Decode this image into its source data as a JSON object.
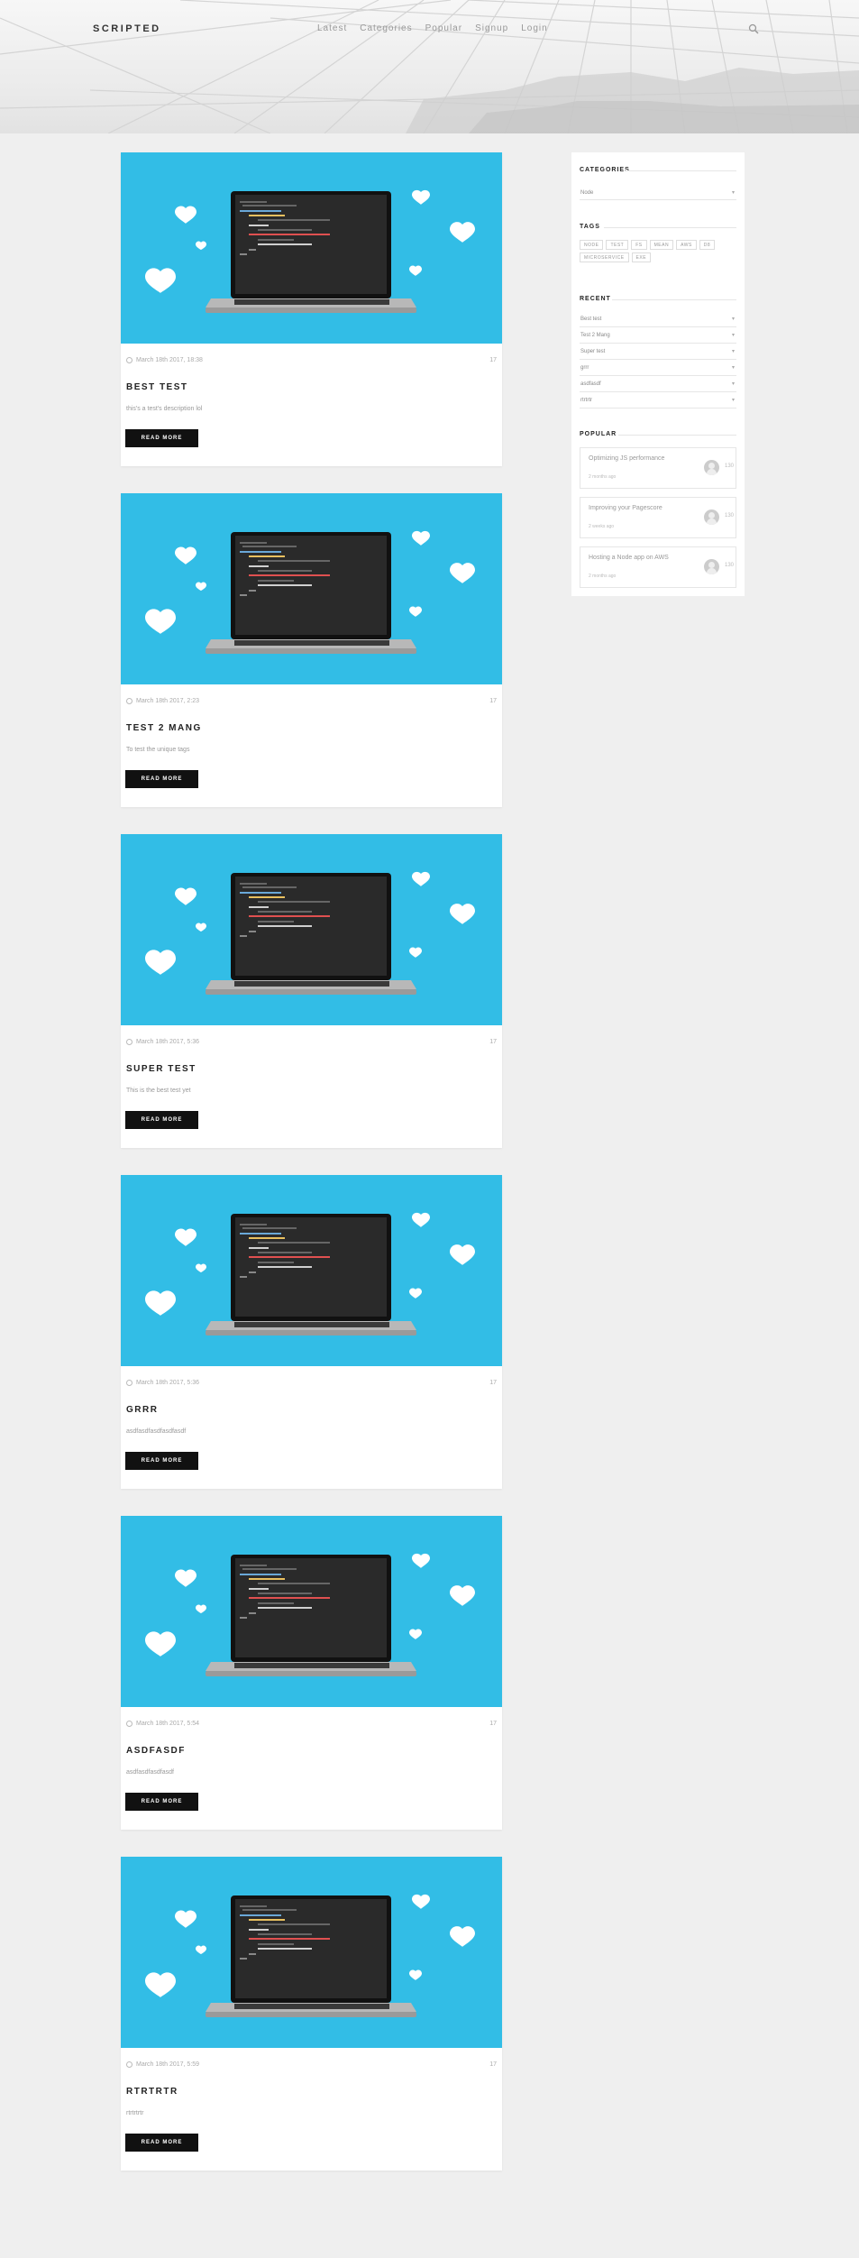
{
  "header": {
    "logo": "SCRIPTED",
    "nav": [
      "Latest",
      "Categories",
      "Popular",
      "Signup",
      "Login"
    ]
  },
  "posts": [
    {
      "date": "March 18th 2017, 18:38",
      "comments": "17",
      "title": "BEST TEST",
      "desc": "this's a test's description lol",
      "read_more": "READ MORE"
    },
    {
      "date": "March 18th 2017, 2:23",
      "comments": "17",
      "title": "TEST 2 MANG",
      "desc": "To test the unique tags",
      "read_more": "READ MORE"
    },
    {
      "date": "March 18th 2017, 5:36",
      "comments": "17",
      "title": "SUPER TEST",
      "desc": "This is the best test yet",
      "read_more": "READ MORE"
    },
    {
      "date": "March 18th 2017, 5:36",
      "comments": "17",
      "title": "GRRR",
      "desc": "asdfasdfasdfasdfasdf",
      "read_more": "READ MORE"
    },
    {
      "date": "March 18th 2017, 5:54",
      "comments": "17",
      "title": "ASDFASDF",
      "desc": "asdfasdfasdfasdf",
      "read_more": "READ MORE"
    },
    {
      "date": "March 18th 2017, 5:59",
      "comments": "17",
      "title": "RTRTRTR",
      "desc": "rtrtrtrtr",
      "read_more": "READ MORE"
    }
  ],
  "sidebar": {
    "categories": {
      "title": "CATEGORIES",
      "selected": "Node"
    },
    "tags": {
      "title": "TAGS",
      "items": [
        "NODE",
        "TEST",
        "FS",
        "MEAN",
        "AWS",
        "D8",
        "MICROSERVICE",
        "EXE"
      ]
    },
    "recent": {
      "title": "RECENT",
      "items": [
        "Best test",
        "Test 2 Mang",
        "Super test",
        "grrr",
        "asdfasdf",
        "rtrtrtr"
      ]
    },
    "popular": {
      "title": "POPULAR",
      "items": [
        {
          "title": "Optimizing JS performance",
          "date": "2 months ago",
          "count": "130"
        },
        {
          "title": "Improving your Pagescore",
          "date": "2 weeks ago",
          "count": "130"
        },
        {
          "title": "Hosting a Node app on AWS",
          "date": "2 months ago",
          "count": "130"
        }
      ]
    }
  },
  "colors": {
    "accent": "#32bde6",
    "button": "#111111",
    "page_bg": "#efefef"
  },
  "icons": [
    "search-icon",
    "clock-icon",
    "heart-icon",
    "laptop-icon",
    "caret-down-icon",
    "avatar-icon"
  ]
}
